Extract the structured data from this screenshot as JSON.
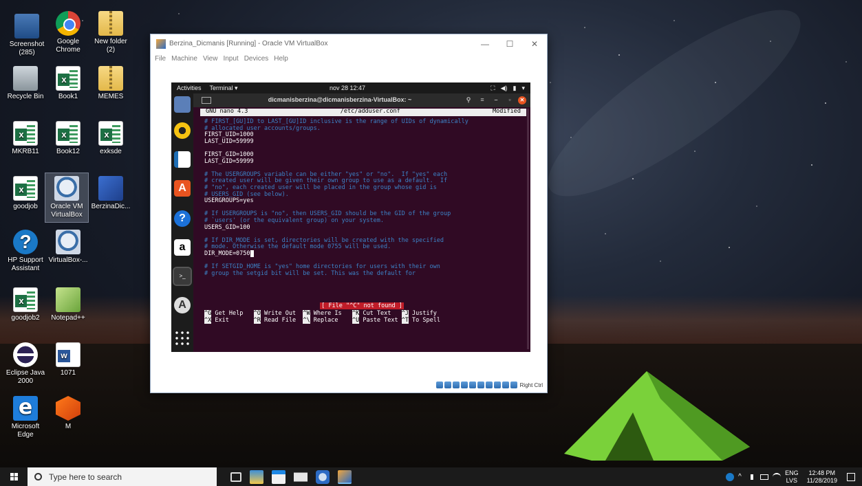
{
  "desktop": {
    "icons": [
      {
        "label": "Screenshot (285)",
        "icon": "screenshot-icon"
      },
      {
        "label": "Google Chrome",
        "icon": "chrome-icon"
      },
      {
        "label": "New folder (2)",
        "icon": "folder-icon"
      },
      {
        "label": "Recycle Bin",
        "icon": "recycle-bin-icon"
      },
      {
        "label": "Book1",
        "icon": "excel-icon"
      },
      {
        "label": "MEMES",
        "icon": "folder-icon"
      },
      {
        "label": "MKRB11",
        "icon": "document-icon"
      },
      {
        "label": "Book12",
        "icon": "excel-icon"
      },
      {
        "label": "exksde",
        "icon": "excel-icon"
      },
      {
        "label": "goodjob",
        "icon": "excel-icon"
      },
      {
        "label": "Oracle VM VirtualBox",
        "icon": "virtualbox-icon"
      },
      {
        "label": "BerzinaDic...",
        "icon": "vm-icon"
      },
      {
        "label": "HP Support Assistant",
        "icon": "hp-help-icon"
      },
      {
        "label": "VirtualBox-...",
        "icon": "virtualbox-icon"
      },
      {
        "label": "goodjob2",
        "icon": "excel-icon"
      },
      {
        "label": "Notepad++",
        "icon": "notepad-icon"
      },
      {
        "label": "Eclipse Java 2000",
        "icon": "eclipse-icon"
      },
      {
        "label": "1071",
        "icon": "word-icon"
      },
      {
        "label": "Microsoft Edge",
        "icon": "edge-icon"
      },
      {
        "label": "M",
        "icon": "app-icon"
      }
    ]
  },
  "vbox": {
    "title": "Berzina_Dicmanis [Running] - Oracle VM VirtualBox",
    "menu": [
      "File",
      "Machine",
      "View",
      "Input",
      "Devices",
      "Help"
    ],
    "minimize": "—",
    "maximize": "☐",
    "close": "✕",
    "host_key": "Right Ctrl"
  },
  "ubuntu": {
    "activities": "Activities",
    "app_menu": "Terminal ▾",
    "clock": "nov 28  12:47",
    "terminal_title": "dicmanisberzina@dicmanisberzina-VirtualBox: ~"
  },
  "nano": {
    "version": "GNU nano 4.3",
    "file": "/etc/adduser.conf",
    "state": "Modified",
    "lines": [
      {
        "t": "# FIRST_[GU]ID to LAST_[GU]ID inclusive is the range of UIDs of dynamically",
        "c": true
      },
      {
        "t": "# allocated user accounts/groups.",
        "c": true
      },
      {
        "t": "FIRST_UID=1000",
        "c": false
      },
      {
        "t": "LAST_UID=59999",
        "c": false
      },
      {
        "t": "",
        "c": false
      },
      {
        "t": "FIRST_GID=1000",
        "c": false
      },
      {
        "t": "LAST_GID=59999",
        "c": false
      },
      {
        "t": "",
        "c": false
      },
      {
        "t": "# The USERGROUPS variable can be either \"yes\" or \"no\".  If \"yes\" each",
        "c": true
      },
      {
        "t": "# created user will be given their own group to use as a default.  If",
        "c": true
      },
      {
        "t": "# \"no\", each created user will be placed in the group whose gid is",
        "c": true
      },
      {
        "t": "# USERS_GID (see below).",
        "c": true
      },
      {
        "t": "USERGROUPS=yes",
        "c": false
      },
      {
        "t": "",
        "c": false
      },
      {
        "t": "# If USERGROUPS is \"no\", then USERS_GID should be the GID of the group",
        "c": true
      },
      {
        "t": "# `users' (or the equivalent group) on your system.",
        "c": true
      },
      {
        "t": "USERS_GID=100",
        "c": false
      },
      {
        "t": "",
        "c": false
      },
      {
        "t": "# If DIR_MODE is set, directories will be created with the specified",
        "c": true
      },
      {
        "t": "# mode. Otherwise the default mode 0755 will be used.",
        "c": true
      },
      {
        "t": "DIR_MODE=0750",
        "c": false,
        "cursor": true
      },
      {
        "t": "",
        "c": false
      },
      {
        "t": "# If SETGID_HOME is \"yes\" home directories for users with their own",
        "c": true
      },
      {
        "t": "# group the setgid bit will be set. This was the default for",
        "c": true
      }
    ],
    "message": "[ File \"^C\" not found ]",
    "shortcuts_row1": [
      {
        "k": "^G",
        "l": "Get Help"
      },
      {
        "k": "^O",
        "l": "Write Out"
      },
      {
        "k": "^W",
        "l": "Where Is"
      },
      {
        "k": "^K",
        "l": "Cut Text"
      },
      {
        "k": "^J",
        "l": "Justify"
      }
    ],
    "shortcuts_row2": [
      {
        "k": "^X",
        "l": "Exit"
      },
      {
        "k": "^R",
        "l": "Read File"
      },
      {
        "k": "^\\",
        "l": "Replace"
      },
      {
        "k": "^U",
        "l": "Paste Text"
      },
      {
        "k": "^T",
        "l": "To Spell"
      }
    ]
  },
  "taskbar": {
    "search_placeholder": "Type here to search",
    "lang_top": "ENG",
    "lang_bottom": "LVS",
    "time": "12:48 PM",
    "date": "11/28/2019"
  }
}
